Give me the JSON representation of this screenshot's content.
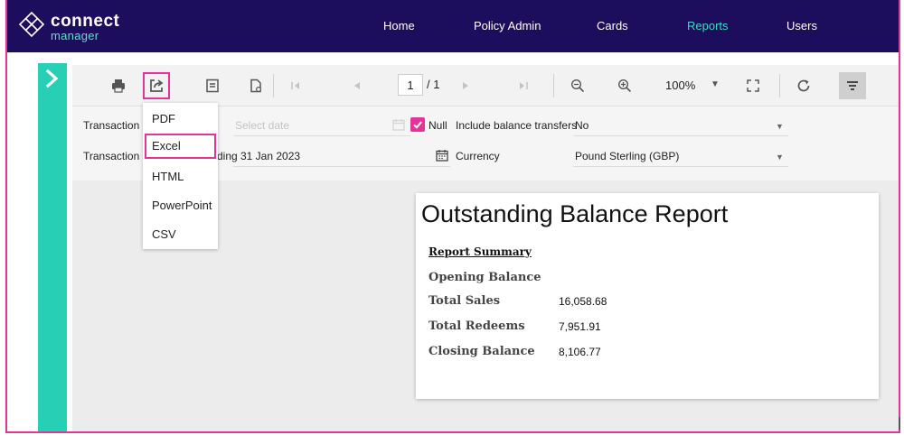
{
  "brand": {
    "name_top": "connect",
    "name_bottom": "manager"
  },
  "nav": {
    "items": [
      {
        "label": "Home"
      },
      {
        "label": "Policy Admin"
      },
      {
        "label": "Cards"
      },
      {
        "label": "Reports"
      },
      {
        "label": "Users"
      }
    ]
  },
  "toolbar": {
    "page_current": "1",
    "page_total": "/ 1",
    "zoom": "100%"
  },
  "export_menu": {
    "items": [
      {
        "label": "PDF"
      },
      {
        "label": "Excel"
      },
      {
        "label": "HTML"
      },
      {
        "label": "PowerPoint"
      },
      {
        "label": "CSV"
      }
    ]
  },
  "filters": {
    "row1": {
      "label": "Transaction",
      "date_placeholder": "Select date",
      "null_label": "Null",
      "include_label": "Include balance transfers",
      "include_value": "No"
    },
    "row2": {
      "label": "Transaction",
      "label_suffix": "ding",
      "date_value": "31 Jan 2023",
      "currency_label": "Currency",
      "currency_value": "Pound Sterling (GBP)"
    }
  },
  "report": {
    "title": "Outstanding Balance Report",
    "summary_heading": "Report Summary",
    "rows": [
      {
        "label": "Opening Balance",
        "value": ""
      },
      {
        "label": "Total Sales",
        "value": "16,058.68"
      },
      {
        "label": "Total Redeems",
        "value": "7,951.91"
      },
      {
        "label": "Closing  Balance",
        "value": "8,106.77"
      }
    ]
  },
  "colors": {
    "nav_bg": "#1c0e5c",
    "accent_teal": "#27cfb4",
    "highlight_pink": "#e6339a"
  }
}
